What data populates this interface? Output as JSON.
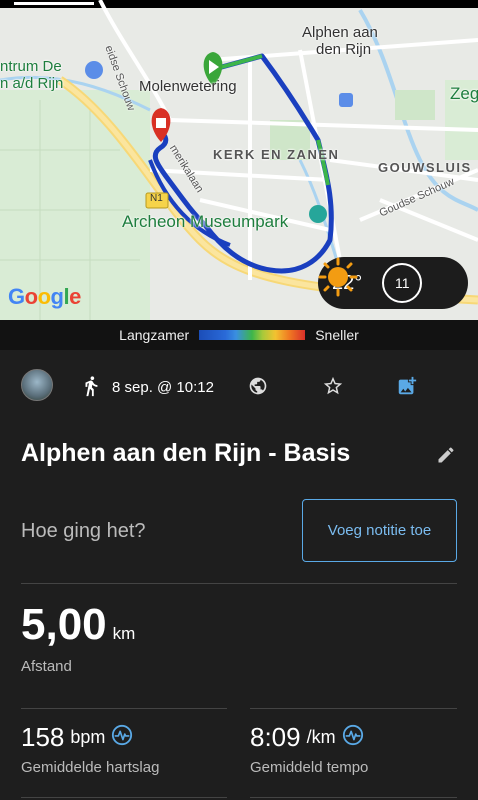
{
  "map": {
    "labels": {
      "alphen": "Alphen aan den Rijn",
      "alphen_line1": "Alphen aan",
      "alphen_line2": "den Rijn",
      "molenwetering": "Molenwetering",
      "kerk": "KERK EN ZANEN",
      "gouwsluis": "GOUWSLUIS",
      "archeon": "Archeon Museumpark",
      "centrum_line1": "ntrum De",
      "centrum_line2": "n a/d Rijn",
      "zeg": "Zeg",
      "goudse": "Goudse Schouw",
      "eidse": "eidse Schouw",
      "amerika": "merikalaan",
      "road_n": "N1"
    },
    "google": "Google",
    "weather": {
      "temp": "22°",
      "hour": "11"
    }
  },
  "legend": {
    "slower": "Langzamer",
    "faster": "Sneller"
  },
  "activity": {
    "date": "8 sep. @ 10:12",
    "title": "Alphen aan den Rijn - Basis",
    "prompt": "Hoe ging het?",
    "note_button": "Voeg notitie toe"
  },
  "stats": {
    "distance": {
      "value": "5,00",
      "unit": "km",
      "label": "Afstand"
    },
    "heart_rate": {
      "value": "158",
      "unit": "bpm",
      "label": "Gemiddelde hartslag"
    },
    "pace": {
      "value": "8:09",
      "unit": "/km",
      "label": "Gemiddeld tempo"
    }
  },
  "colors": {
    "accent": "#7bbcf0",
    "route": "#1a3fbf",
    "start": "#3aa63a",
    "end": "#d93025"
  },
  "icons": [
    "runner-icon",
    "globe-icon",
    "star-icon",
    "add-photo-icon",
    "edit-pencil-icon",
    "pulse-icon",
    "sun-icon"
  ]
}
